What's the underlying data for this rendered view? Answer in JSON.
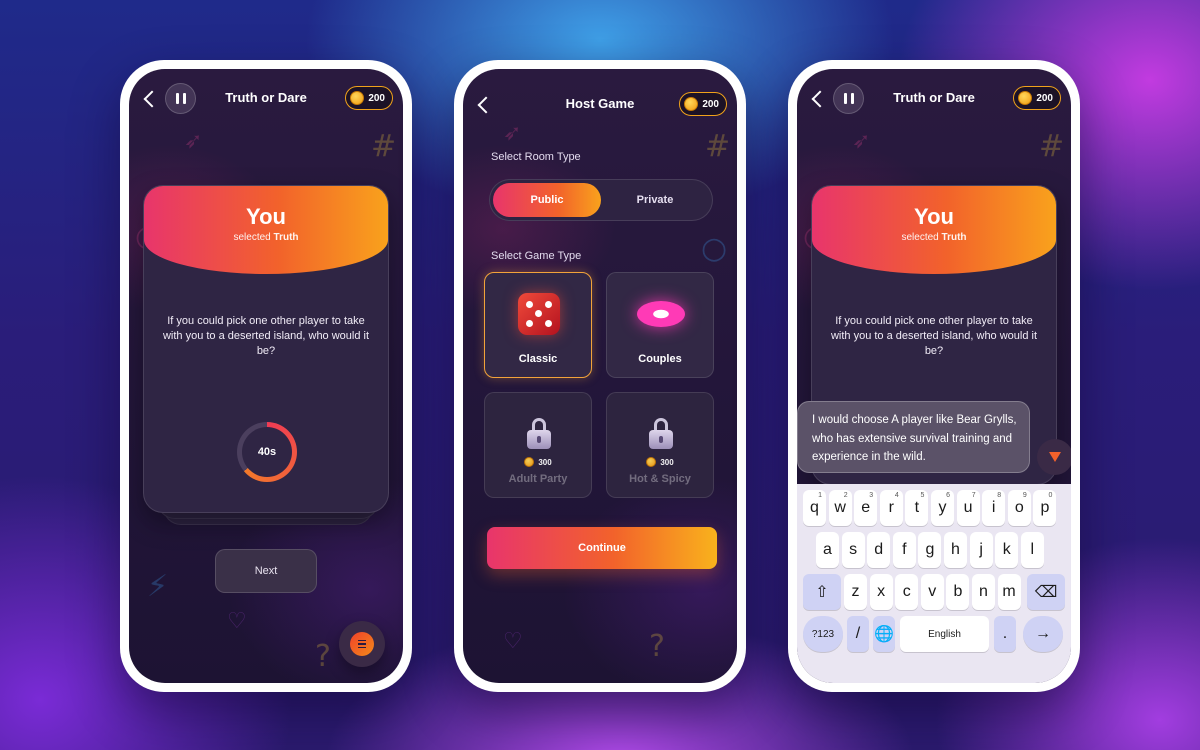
{
  "screen1": {
    "title": "Truth or Dare",
    "coins": "200",
    "card": {
      "heading": "You",
      "selected_prefix": "selected",
      "selected_value": "Truth",
      "question": "If you could pick one other player to take with you to a deserted island, who would it be?",
      "timer": "40s",
      "timer_remaining_fraction": 0.64
    },
    "next_label": "Next"
  },
  "screen2": {
    "title": "Host Game",
    "coins": "200",
    "room_type_label": "Select Room Type",
    "room_options": [
      "Public",
      "Private"
    ],
    "room_selected": "Public",
    "game_type_label": "Select Game Type",
    "game_types": [
      {
        "name": "Classic",
        "locked": false,
        "selected": true,
        "icon": "dice-icon"
      },
      {
        "name": "Couples",
        "locked": false,
        "selected": false,
        "icon": "lips-icon"
      },
      {
        "name": "Adult Party",
        "locked": true,
        "price": "300",
        "icon": "lock-icon"
      },
      {
        "name": "Hot & Spicy",
        "locked": true,
        "price": "300",
        "icon": "lock-icon"
      }
    ],
    "continue_label": "Continue"
  },
  "screen3": {
    "title": "Truth or Dare",
    "coins": "200",
    "card": {
      "heading": "You",
      "selected_prefix": "selected",
      "selected_value": "Truth",
      "question": "If you could pick one other player to take with you to a deserted island, who would it be?"
    },
    "answer_text": "I would choose  A player like Bear Grylls, who has extensive survival training and experience in the wild.",
    "keyboard": {
      "row1": [
        "q",
        "w",
        "e",
        "r",
        "t",
        "y",
        "u",
        "i",
        "o",
        "p"
      ],
      "row1_hints": [
        "1",
        "2",
        "3",
        "4",
        "5",
        "6",
        "7",
        "8",
        "9",
        "0"
      ],
      "row2": [
        "a",
        "s",
        "d",
        "f",
        "g",
        "h",
        "j",
        "k",
        "l"
      ],
      "row3": [
        "z",
        "x",
        "c",
        "v",
        "b",
        "n",
        "m"
      ],
      "symbols_key": "?123",
      "slash_key": "/",
      "space_label": "English",
      "period_key": "."
    }
  },
  "colors": {
    "accent_start": "#e8356c",
    "accent_mid": "#f2622b",
    "accent_end": "#f9a21c",
    "screen_bg": "#23163a"
  }
}
